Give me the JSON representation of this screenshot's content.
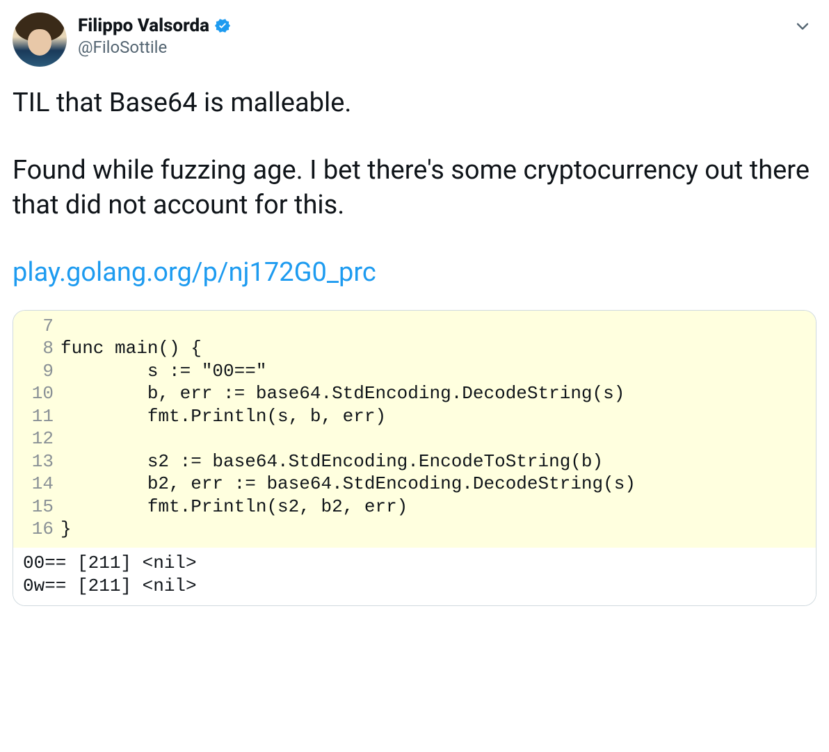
{
  "user": {
    "display_name": "Filippo Valsorda",
    "handle": "@FiloSottile",
    "verified": true
  },
  "tweet": {
    "line1": "TIL that Base64 is malleable.",
    "line2": "Found while fuzzing age. I bet there's some cryptocurrency out there that did not account for this.",
    "link_text": "play.golang.org/p/nj172G0_prc"
  },
  "icons": {
    "verified": "verified-badge-icon",
    "more": "chevron-down-icon"
  },
  "code": {
    "lines": [
      {
        "n": "7",
        "t": ""
      },
      {
        "n": "8",
        "t": "func main() {"
      },
      {
        "n": "9",
        "t": "        s := \"00==\""
      },
      {
        "n": "10",
        "t": "        b, err := base64.StdEncoding.DecodeString(s)"
      },
      {
        "n": "11",
        "t": "        fmt.Println(s, b, err)"
      },
      {
        "n": "12",
        "t": ""
      },
      {
        "n": "13",
        "t": "        s2 := base64.StdEncoding.EncodeToString(b)"
      },
      {
        "n": "14",
        "t": "        b2, err := base64.StdEncoding.DecodeString(s)"
      },
      {
        "n": "15",
        "t": "        fmt.Println(s2, b2, err)"
      },
      {
        "n": "16",
        "t": "}"
      }
    ],
    "output": "00== [211] <nil>\n0w== [211] <nil>"
  }
}
